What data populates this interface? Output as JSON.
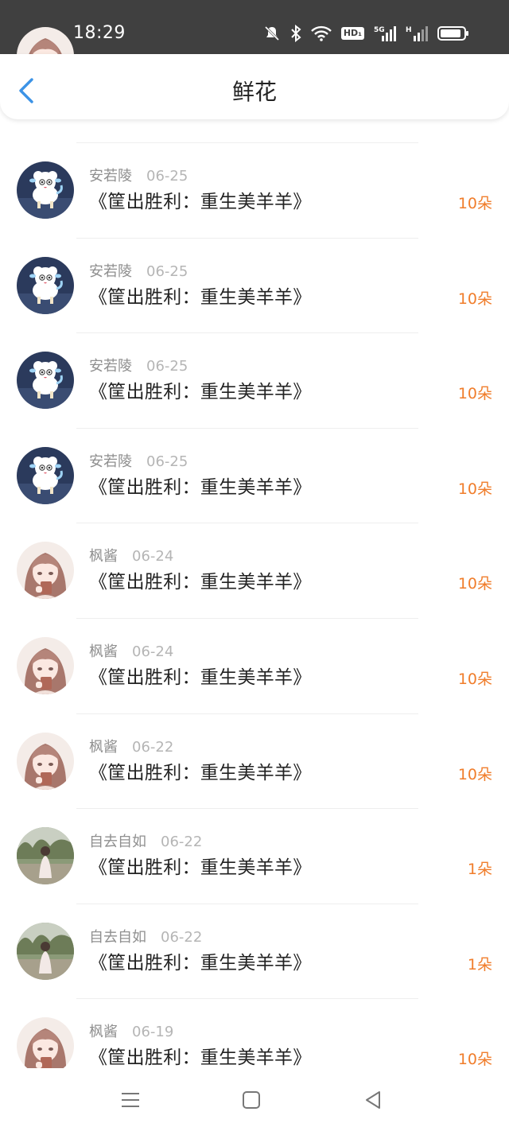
{
  "status_bar": {
    "time": "18:29",
    "hd_badge": "HD₁",
    "network": "5G"
  },
  "header": {
    "title": "鲜花",
    "accent_color": "#3c93e6"
  },
  "colors": {
    "amount": "#f07d2b",
    "name": "#8f8f8f",
    "date": "#b5b5b5",
    "text": "#222222"
  },
  "records": [
    {
      "name": "安若陵",
      "date": "06-25",
      "book": "《筐出胜利：重生美羊羊》",
      "amount": "10朵",
      "avatar": "sheep-avatar"
    },
    {
      "name": "安若陵",
      "date": "06-25",
      "book": "《筐出胜利：重生美羊羊》",
      "amount": "10朵",
      "avatar": "sheep-avatar"
    },
    {
      "name": "安若陵",
      "date": "06-25",
      "book": "《筐出胜利：重生美羊羊》",
      "amount": "10朵",
      "avatar": "sheep-avatar"
    },
    {
      "name": "安若陵",
      "date": "06-25",
      "book": "《筐出胜利：重生美羊羊》",
      "amount": "10朵",
      "avatar": "sheep-avatar"
    },
    {
      "name": "枫酱",
      "date": "06-24",
      "book": "《筐出胜利：重生美羊羊》",
      "amount": "10朵",
      "avatar": "anime-girl-avatar"
    },
    {
      "name": "枫酱",
      "date": "06-24",
      "book": "《筐出胜利：重生美羊羊》",
      "amount": "10朵",
      "avatar": "anime-girl-avatar"
    },
    {
      "name": "枫酱",
      "date": "06-22",
      "book": "《筐出胜利：重生美羊羊》",
      "amount": "10朵",
      "avatar": "anime-girl-avatar"
    },
    {
      "name": "自去自如",
      "date": "06-22",
      "book": "《筐出胜利：重生美羊羊》",
      "amount": "1朵",
      "avatar": "photo-avatar"
    },
    {
      "name": "自去自如",
      "date": "06-22",
      "book": "《筐出胜利：重生美羊羊》",
      "amount": "1朵",
      "avatar": "photo-avatar"
    },
    {
      "name": "枫酱",
      "date": "06-19",
      "book": "《筐出胜利：重生美羊羊》",
      "amount": "10朵",
      "avatar": "anime-girl-avatar"
    }
  ],
  "nav_bar": {
    "icons": [
      "menu-icon",
      "home-square-icon",
      "back-triangle-icon"
    ]
  }
}
